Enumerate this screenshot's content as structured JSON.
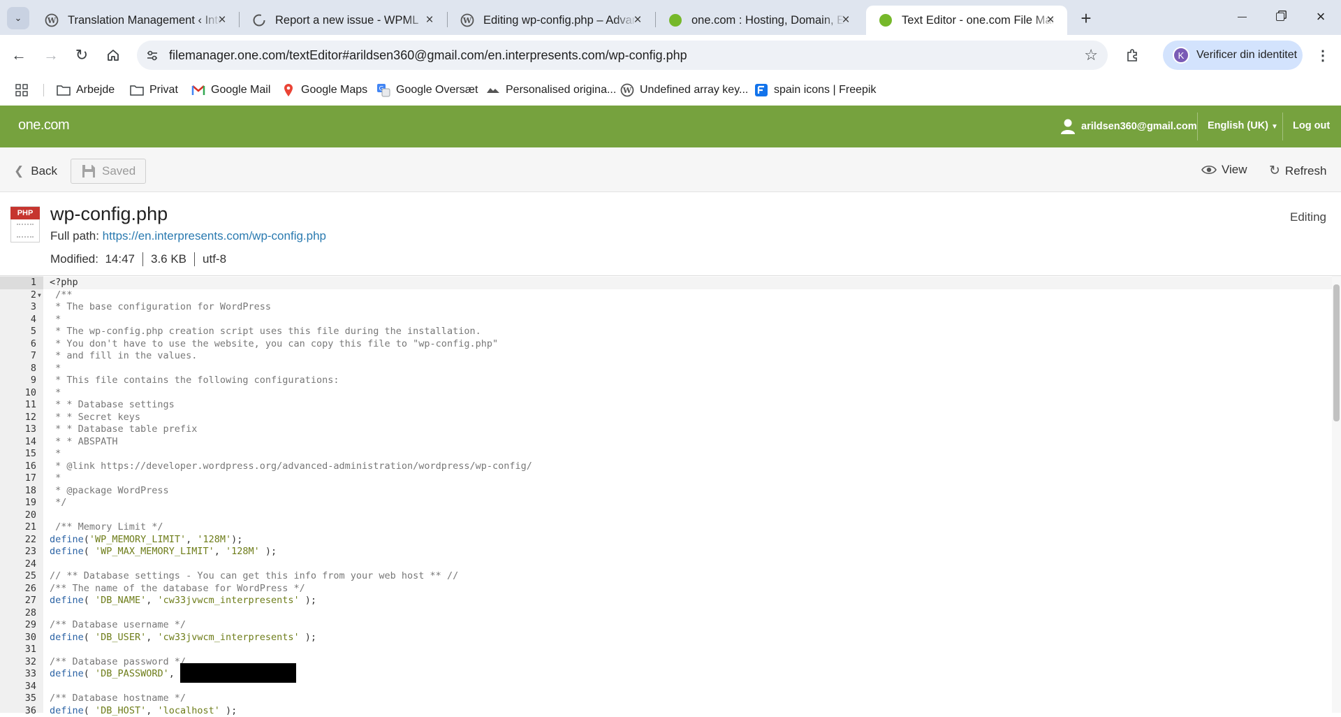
{
  "browser": {
    "tabs": [
      {
        "title": "Translation Management ‹ Inter",
        "icon": "wordpress-icon"
      },
      {
        "title": "Report a new issue - WPML",
        "icon": "wpml-icon"
      },
      {
        "title": "Editing wp-config.php – Advanc",
        "icon": "wordpress-icon"
      },
      {
        "title": "one.com : Hosting, Domain, Em",
        "icon": "onecom-icon"
      },
      {
        "title": "Text Editor - one.com File Mana",
        "icon": "onecom-icon"
      }
    ],
    "url": "filemanager.one.com/textEditor#arildsen360@gmail.com/en.interpresents.com/wp-config.php",
    "profile_label": "Verificer din identitet",
    "profile_initial": "K",
    "bookmarks": [
      "Arbejde",
      "Privat",
      "Google Mail",
      "Google Maps",
      "Google Oversæt",
      "Personalised origina...",
      "Undefined array key...",
      "spain icons | Freepik"
    ]
  },
  "app": {
    "logo": "one.com",
    "user_email": "arildsen360@gmail.com",
    "language": "English (UK)",
    "logout": "Log out",
    "back": "Back",
    "saved": "Saved",
    "view": "View",
    "refresh": "Refresh"
  },
  "file": {
    "name": "wp-config.php",
    "badge": "PHP",
    "path_label": "Full path:",
    "path_url": "https://en.interpresents.com/wp-config.php",
    "modified_label": "Modified:",
    "modified": "14:47",
    "size": "3.6 KB",
    "encoding": "utf-8",
    "mode": "Editing"
  },
  "code_lines": [
    "<?php",
    " /**",
    " * The base configuration for WordPress",
    " *",
    " * The wp-config.php creation script uses this file during the installation.",
    " * You don't have to use the website, you can copy this file to \"wp-config.php\"",
    " * and fill in the values.",
    " *",
    " * This file contains the following configurations:",
    " *",
    " * * Database settings",
    " * * Secret keys",
    " * * Database table prefix",
    " * * ABSPATH",
    " *",
    " * @link https://developer.wordpress.org/advanced-administration/wordpress/wp-config/",
    " *",
    " * @package WordPress",
    " */",
    "",
    " /** Memory Limit */",
    "define('WP_MEMORY_LIMIT', '128M');",
    "define( 'WP_MAX_MEMORY_LIMIT', '128M' );",
    "",
    "// ** Database settings - You can get this info from your web host ** //",
    "/** The name of the database for WordPress */",
    "define( 'DB_NAME', 'cw33jvwcm_interpresents' );",
    "",
    "/** Database username */",
    "define( 'DB_USER', 'cw33jvwcm_interpresents' );",
    "",
    "/** Database password */",
    "define( 'DB_PASSWORD', ",
    "",
    "/** Database hostname */",
    "define( 'DB_HOST', 'localhost' );"
  ]
}
